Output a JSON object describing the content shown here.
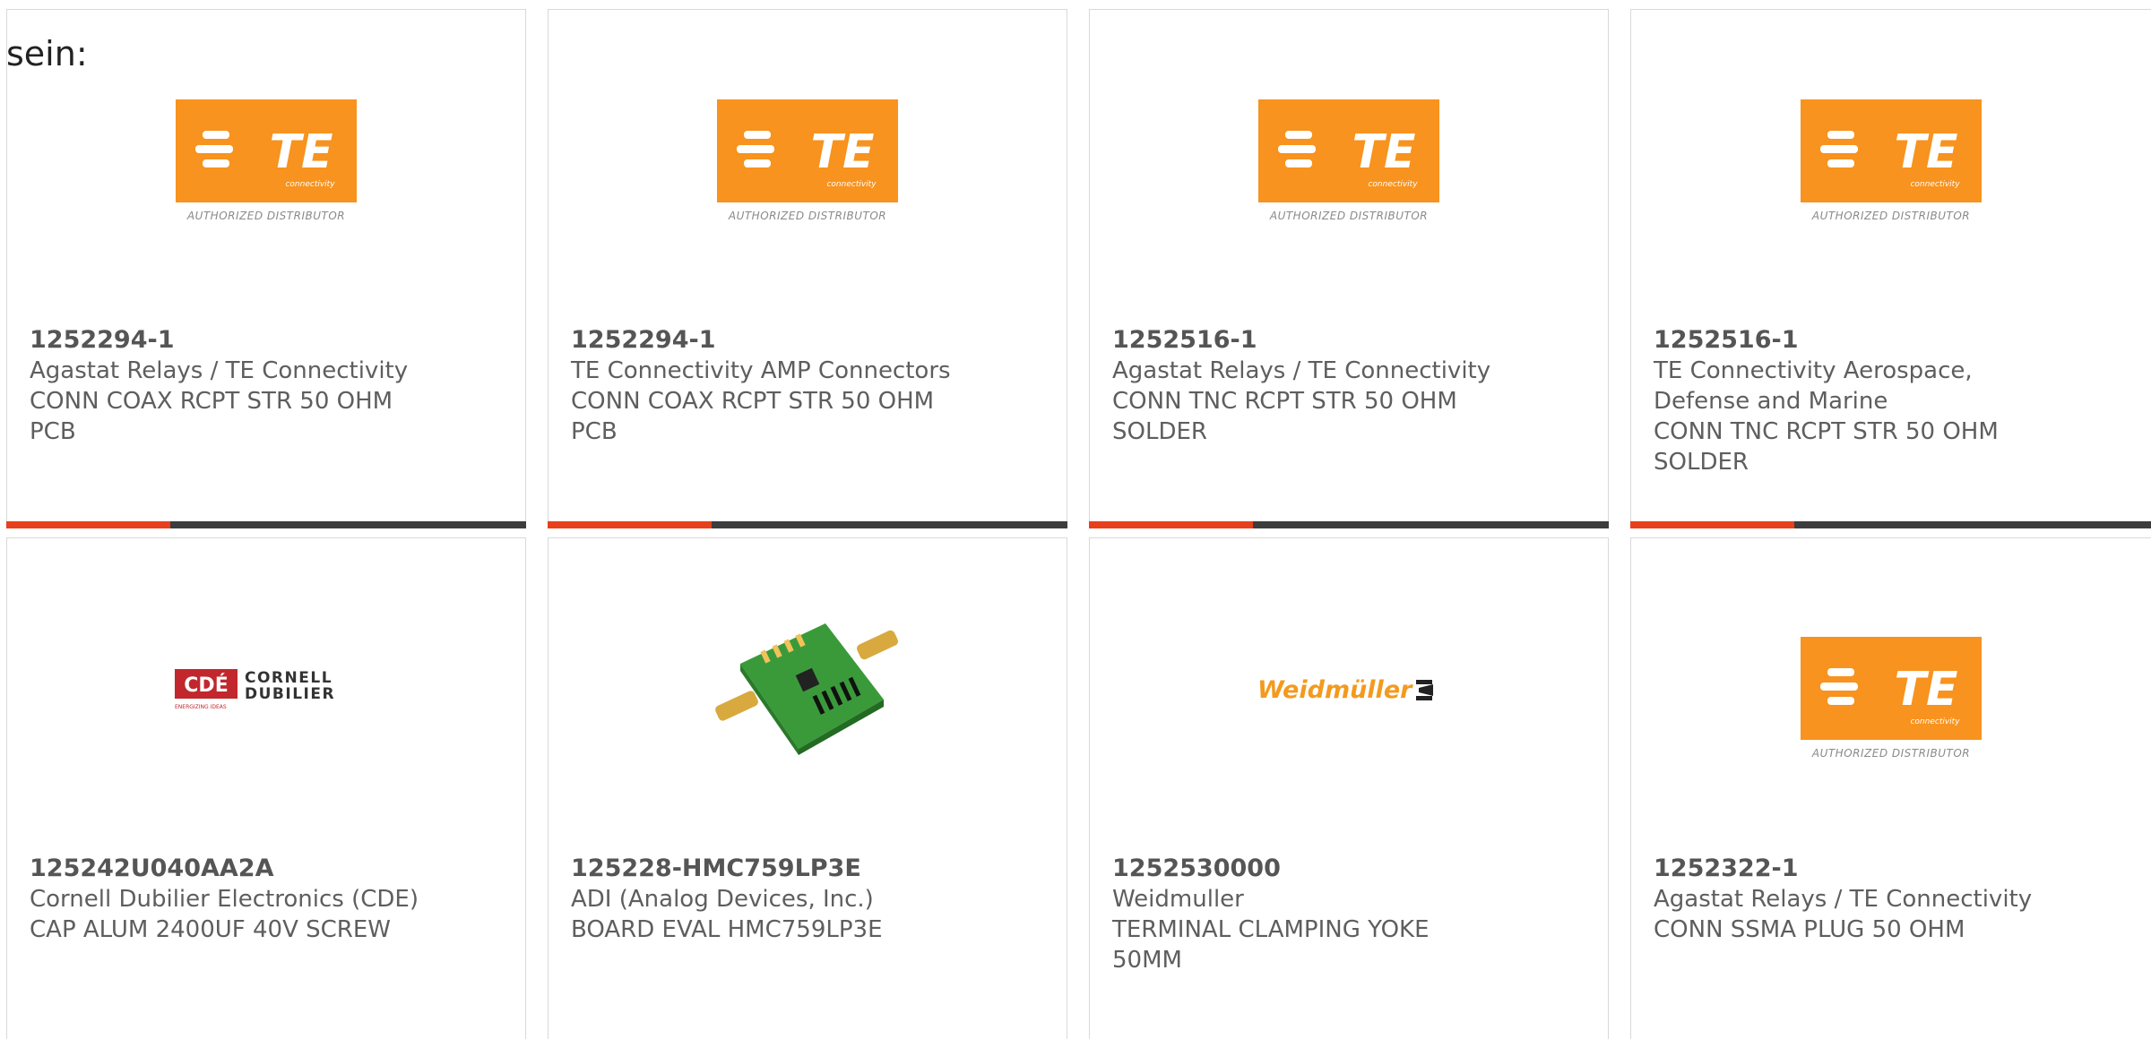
{
  "lead_text": "sein:",
  "colors": {
    "accent": "#e8401c",
    "bar": "#3d3d3d",
    "te_orange": "#f7931e"
  },
  "cards": [
    {
      "part": "1252294-1",
      "lines": [
        "Agastat Relays / TE Connectivity",
        "CONN COAX RCPT STR 50 OHM",
        "PCB"
      ],
      "logo": "te-logo",
      "logo_text": "TE",
      "logo_sub": "connectivity",
      "logo_tag": "AUTHORIZED DISTRIBUTOR"
    },
    {
      "part": "1252294-1",
      "lines": [
        "TE Connectivity AMP Connectors",
        "CONN COAX RCPT STR 50 OHM",
        "PCB"
      ],
      "logo": "te-logo",
      "logo_text": "TE",
      "logo_sub": "connectivity",
      "logo_tag": "AUTHORIZED DISTRIBUTOR"
    },
    {
      "part": "1252516-1",
      "lines": [
        "Agastat Relays / TE Connectivity",
        "CONN TNC RCPT STR 50 OHM",
        "SOLDER"
      ],
      "logo": "te-logo",
      "logo_text": "TE",
      "logo_sub": "connectivity",
      "logo_tag": "AUTHORIZED DISTRIBUTOR"
    },
    {
      "part": "1252516-1",
      "lines": [
        "TE Connectivity Aerospace,",
        "Defense and Marine",
        "CONN TNC RCPT STR 50 OHM",
        "SOLDER"
      ],
      "logo": "te-logo",
      "logo_text": "TE",
      "logo_sub": "connectivity",
      "logo_tag": "AUTHORIZED DISTRIBUTOR"
    },
    {
      "part": "125242U040AA2A",
      "lines": [
        "Cornell Dubilier Electronics (CDE)",
        "CAP ALUM 2400UF 40V SCREW"
      ],
      "logo": "cde-logo",
      "logo_text": "CDÉ",
      "logo_brand_1": "CORNELL",
      "logo_brand_2": "DUBILIER",
      "logo_tag": "ENERGIZING IDEAS"
    },
    {
      "part": "125228-HMC759LP3E",
      "lines": [
        "ADI (Analog Devices, Inc.)",
        "BOARD EVAL HMC759LP3E"
      ],
      "logo": "eval-board-image"
    },
    {
      "part": "1252530000",
      "lines": [
        "Weidmuller",
        "TERMINAL CLAMPING YOKE",
        "50MM"
      ],
      "logo": "weidmuller-logo",
      "logo_text": "Weidmüller"
    },
    {
      "part": "1252322-1",
      "lines": [
        "Agastat Relays / TE Connectivity",
        "CONN SSMA PLUG 50 OHM"
      ],
      "logo": "te-logo",
      "logo_text": "TE",
      "logo_sub": "connectivity",
      "logo_tag": "AUTHORIZED DISTRIBUTOR"
    }
  ]
}
